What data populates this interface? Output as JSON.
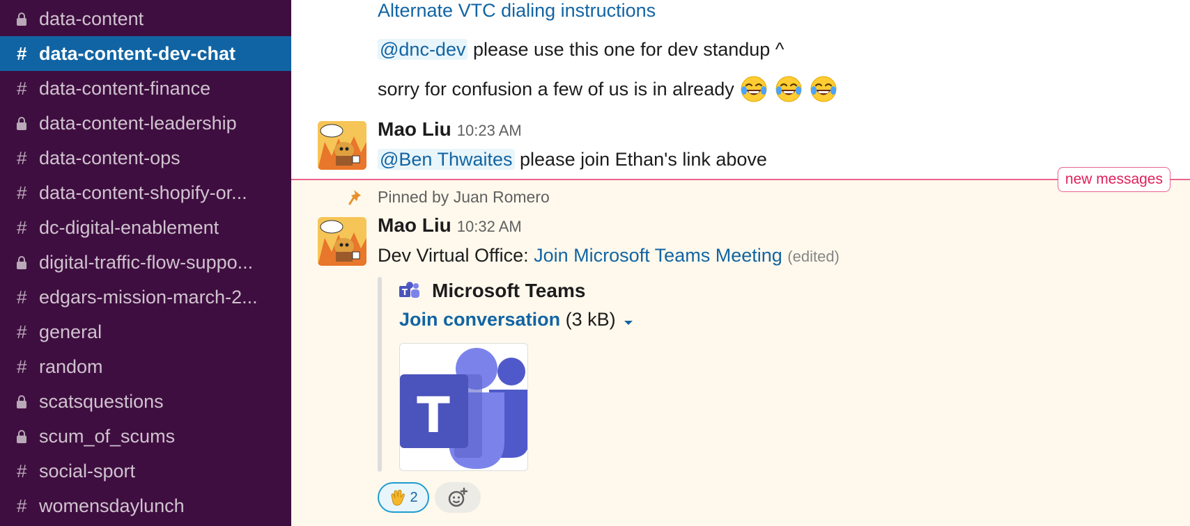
{
  "sidebar": {
    "channels": [
      {
        "name": "data-content",
        "type": "private",
        "active": false
      },
      {
        "name": "data-content-dev-chat",
        "type": "public",
        "active": true
      },
      {
        "name": "data-content-finance",
        "type": "public",
        "active": false
      },
      {
        "name": "data-content-leadership",
        "type": "private",
        "active": false
      },
      {
        "name": "data-content-ops",
        "type": "public",
        "active": false
      },
      {
        "name": "data-content-shopify-or...",
        "type": "public",
        "active": false
      },
      {
        "name": "dc-digital-enablement",
        "type": "public",
        "active": false
      },
      {
        "name": "digital-traffic-flow-suppo...",
        "type": "private",
        "active": false
      },
      {
        "name": "edgars-mission-march-2...",
        "type": "public",
        "active": false
      },
      {
        "name": "general",
        "type": "public",
        "active": false
      },
      {
        "name": "random",
        "type": "public",
        "active": false
      },
      {
        "name": "scatsquestions",
        "type": "private",
        "active": false
      },
      {
        "name": "scum_of_scums",
        "type": "private",
        "active": false
      },
      {
        "name": "social-sport",
        "type": "public",
        "active": false
      },
      {
        "name": "womensdaylunch",
        "type": "public",
        "active": false
      }
    ],
    "public_prefix": "#",
    "icons": {
      "public": "hash-icon",
      "private": "lock-icon"
    }
  },
  "messages": {
    "top_link": "Alternate VTC dialing instructions",
    "m1": {
      "mention": "@dnc-dev",
      "text": "please use this one for dev standup ^"
    },
    "m2": {
      "text": "sorry for confusion a few of us is in already",
      "emoji": "joy-emoji",
      "emoji_count": 3
    },
    "m3": {
      "author": "Mao Liu",
      "time": "10:23 AM",
      "mention": "@Ben Thwaites",
      "text": "please join Ethan's link above"
    },
    "divider_label": "new messages",
    "pinned": {
      "label": "Pinned by Juan Romero",
      "author": "Mao Liu",
      "time": "10:32 AM",
      "prefix": "Dev Virtual Office:",
      "link": "Join Microsoft Teams Meeting",
      "edited": "(edited)",
      "attachment": {
        "service": "Microsoft Teams",
        "link": "Join conversation",
        "size": "(3 kB)"
      },
      "reaction": {
        "emoji": "clap-emoji",
        "count": "2"
      }
    }
  },
  "colors": {
    "sidebar_bg": "#3f0e40",
    "active_channel": "#1164a3",
    "link": "#1264a3",
    "new_messages": "#e01e5a",
    "pinned_bg": "#fef9ec",
    "teams_purple": "#5059c9"
  }
}
